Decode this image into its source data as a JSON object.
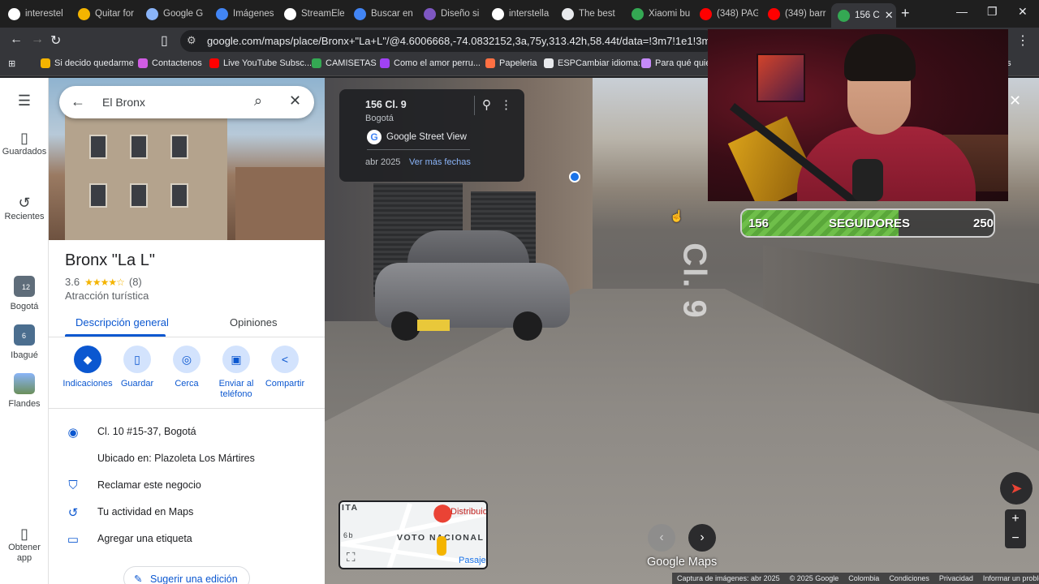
{
  "browser": {
    "tabs": [
      {
        "label": "interestel",
        "favicon": "google-icon",
        "color": "#ffffff"
      },
      {
        "label": "Quitar for",
        "favicon": "doc-icon",
        "color": "#f4b400"
      },
      {
        "label": "Google G",
        "favicon": "gemini-icon",
        "color": "#8ab4f8"
      },
      {
        "label": "Imágenes",
        "favicon": "docs-icon",
        "color": "#4285f4"
      },
      {
        "label": "StreamEle",
        "favicon": "streamelements-icon",
        "color": "#ffffff"
      },
      {
        "label": "Buscar en",
        "favicon": "lens-icon",
        "color": "#4285f4"
      },
      {
        "label": "Diseño si",
        "favicon": "design-icon",
        "color": "#7e57c2"
      },
      {
        "label": "interstella",
        "favicon": "google-icon",
        "color": "#ffffff"
      },
      {
        "label": "The best",
        "favicon": "diamond-icon",
        "color": "#e8eaed"
      },
      {
        "label": "Xiaomi bu",
        "favicon": "x-icon",
        "color": "#34a853"
      },
      {
        "label": "(348) PAG",
        "favicon": "youtube-icon",
        "color": "#ff0000"
      },
      {
        "label": "(349) barr",
        "favicon": "youtube-icon",
        "color": "#ff0000"
      },
      {
        "label": "156 C",
        "favicon": "maps-icon",
        "color": "#34a853"
      }
    ],
    "url": "google.com/maps/place/Bronx+\"La+L\"/@4.6006668,-74.0832152,3a,75y,313.42h,58.44t/data=!3m7!1e1!3m5!1sskSd...",
    "bookmarks": [
      {
        "label": "Si decido quedarme",
        "color": "#f4b400"
      },
      {
        "label": "Contactenos",
        "color": "#d05ce3"
      },
      {
        "label": "Live YouTube Subsc...",
        "color": "#ff0000"
      },
      {
        "label": "CAMISETAS",
        "color": "#34a853"
      },
      {
        "label": "Como el amor perru...",
        "color": "#a142f4"
      },
      {
        "label": "Papeleria",
        "color": "#ff7043"
      },
      {
        "label": "ESPCambiar idioma:",
        "color": "#e8eaed"
      },
      {
        "label": "Para qué quiero",
        "color": "#c58af9"
      },
      {
        "label": "adores",
        "color": "#e8eaed"
      }
    ]
  },
  "rail": {
    "saved_label": "Guardados",
    "recent_label": "Recientes",
    "recents": [
      {
        "label": "Bogotá",
        "count": "12"
      },
      {
        "label": "Ibagué",
        "count": "6"
      },
      {
        "label": "Flandes",
        "count": ""
      }
    ],
    "get_app_label": "Obtener app"
  },
  "panel": {
    "search_value": "El Bronx",
    "place_name": "Bronx \"La L\"",
    "rating": "3.6",
    "stars": "★★★★☆",
    "review_count": "(8)",
    "category": "Atracción turística",
    "tabs": [
      "Descripción general",
      "Opiniones"
    ],
    "actions": [
      {
        "label": "Indicaciones",
        "icon": "directions-icon",
        "glyph": "◆"
      },
      {
        "label": "Guardar",
        "icon": "bookmark-icon",
        "glyph": "▯"
      },
      {
        "label": "Cerca",
        "icon": "nearby-icon",
        "glyph": "◎"
      },
      {
        "label": "Enviar al teléfono",
        "icon": "send-to-phone-icon",
        "glyph": "▣"
      },
      {
        "label": "Compartir",
        "icon": "share-icon",
        "glyph": "<"
      }
    ],
    "info": [
      {
        "icon": "location-pin-icon",
        "glyph": "◉",
        "text": "Cl. 10 #15-37, Bogotá"
      },
      {
        "icon": "",
        "glyph": "",
        "text": "Ubicado en: Plazoleta Los Mártires"
      },
      {
        "icon": "verified-icon",
        "glyph": "⛉",
        "text": "Reclamar este negocio"
      },
      {
        "icon": "history-icon",
        "glyph": "↺",
        "text": "Tu actividad en Maps"
      },
      {
        "icon": "label-icon",
        "glyph": "▭",
        "text": "Agregar una etiqueta"
      }
    ],
    "suggest_edit": "Sugerir una edición"
  },
  "streetview": {
    "address": "156 Cl. 9",
    "city": "Bogotá",
    "source": "Google Street View",
    "date": "abr 2025",
    "more_dates": "Ver más fechas",
    "road_paint": "Cl. 9",
    "logo": "Google Maps",
    "minimap": {
      "label_ita": "ITA",
      "label_voto": "VOTO NACIONAL",
      "label_distri": "Distribuid",
      "label_pasaje": "Pasaje",
      "label_6b": "6b"
    },
    "footer": [
      "Captura de imágenes: abr 2025",
      "© 2025 Google",
      "Colombia",
      "Condiciones",
      "Privacidad",
      "Informar un problema"
    ]
  },
  "overlay": {
    "followers_current": "156",
    "followers_label": "SEGUIDORES",
    "followers_goal": "250",
    "progress_fraction": 0.624
  }
}
